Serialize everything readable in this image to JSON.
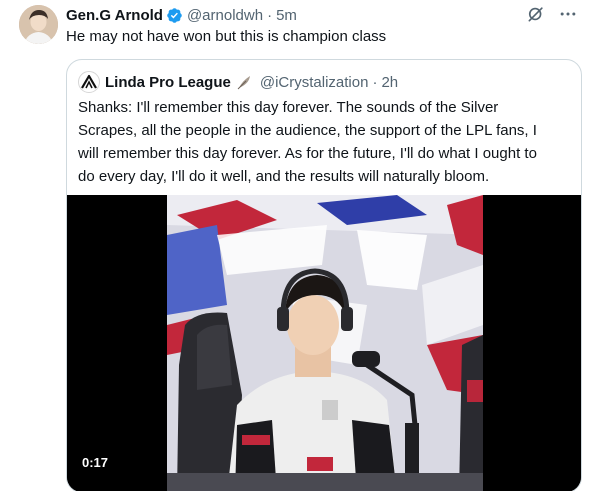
{
  "author": {
    "display_name": "Gen.G Arnold",
    "handle": "@arnoldwh",
    "separator": "·",
    "time": "5m",
    "verified_icon": "verified-badge-icon"
  },
  "tweet": {
    "text": "He may not have won but this is champion class"
  },
  "actions": {
    "icons": [
      "grok-icon",
      "more-icon"
    ]
  },
  "quoted_tweet": {
    "display_name": "Linda Pro League",
    "handle": "@iCrystalization",
    "separator": "·",
    "time": "2h",
    "text_lines": [
      "Shanks: I'll remember this day forever. The sounds of the Silver",
      "Scrapes, all the people in the audience, the support of the LPL fans, I",
      "will remember this day forever. As for the future, I'll do what I ought to",
      "do every day, I'll do it well, and the results will naturally bloom."
    ],
    "video": {
      "duration": "0:17"
    }
  },
  "colors": {
    "text_primary": "#0f1419",
    "text_secondary": "#536471",
    "verified_blue": "#1d9bf0",
    "border": "#cfd9de"
  }
}
